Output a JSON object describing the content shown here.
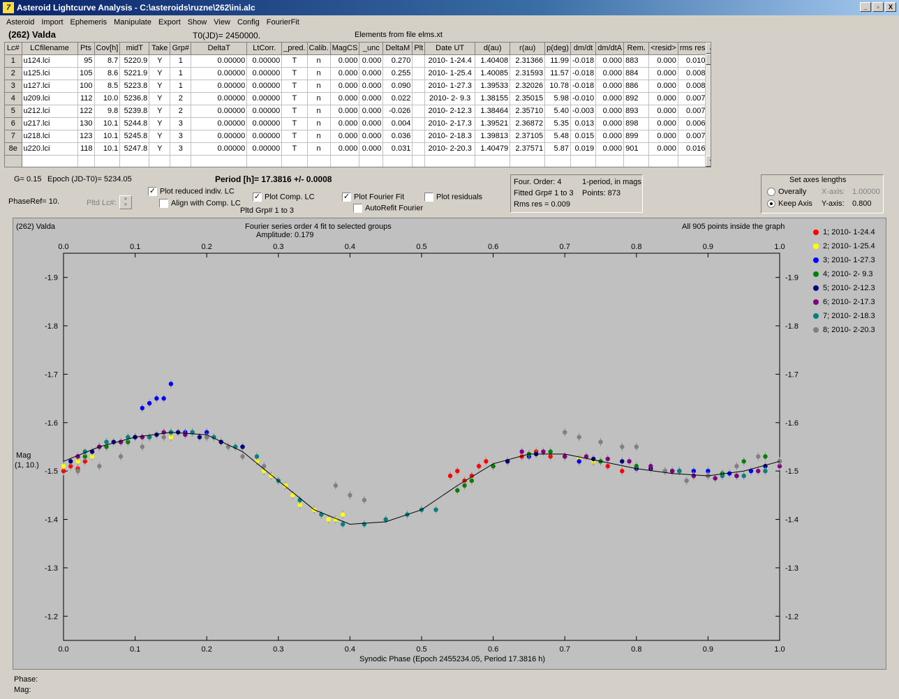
{
  "window": {
    "title": "Asteroid Lightcurve Analysis - C:\\asteroids\\ruzne\\262\\ini.alc",
    "app_icon_glyph": "7",
    "minimize_glyph": "_",
    "restore_glyph": "▫",
    "close_glyph": "X"
  },
  "menu": [
    "Asteroid",
    "Import",
    "Ephemeris",
    "Manipulate",
    "Export",
    "Show",
    "View",
    "Config",
    "FourierFit"
  ],
  "header": {
    "asteroid": "(262) Valda",
    "t0": "T0(JD)= 2450000.",
    "elements": "Elements from file elms.xt"
  },
  "table": {
    "columns": [
      "Lc#",
      "LCfilename",
      "Pts",
      "Cov[h]",
      "midT",
      "Take",
      "Grp#",
      "DeltaT",
      "LtCorr.",
      "_pred.",
      "Calib.",
      "MagCS",
      "_unc",
      "DeltaM",
      "Plt",
      "Date UT",
      "d(au)",
      "r(au)",
      "p(deg)",
      "dm/dt",
      "dm/dtA",
      "Rem.",
      "<resid>",
      "rms res"
    ],
    "rows": [
      [
        "1",
        "u124.lci",
        "95",
        "8.7",
        "5220.9",
        "Y",
        "1",
        "0.00000",
        "0.00000",
        "T",
        "n",
        "0.000",
        "0.000",
        "0.270",
        "",
        "2010- 1-24.4",
        "1.40408",
        "2.31366",
        "11.99",
        "-0.018",
        "0.000",
        "883",
        "0.000",
        "0.010"
      ],
      [
        "2",
        "u125.lci",
        "105",
        "8.6",
        "5221.9",
        "Y",
        "1",
        "0.00000",
        "0.00000",
        "T",
        "n",
        "0.000",
        "0.000",
        "0.255",
        "",
        "2010- 1-25.4",
        "1.40085",
        "2.31593",
        "11.57",
        "-0.018",
        "0.000",
        "884",
        "0.000",
        "0.008"
      ],
      [
        "3",
        "u127.lci",
        "100",
        "8.5",
        "5223.8",
        "Y",
        "1",
        "0.00000",
        "0.00000",
        "T",
        "n",
        "0.000",
        "0.000",
        "0.090",
        "",
        "2010- 1-27.3",
        "1.39533",
        "2.32026",
        "10.78",
        "-0.018",
        "0.000",
        "886",
        "0.000",
        "0.008"
      ],
      [
        "4",
        "u209.lci",
        "112",
        "10.0",
        "5236.8",
        "Y",
        "2",
        "0.00000",
        "0.00000",
        "T",
        "n",
        "0.000",
        "0.000",
        "0.022",
        "",
        "2010- 2- 9.3",
        "1.38155",
        "2.35015",
        "5.98",
        "-0.010",
        "0.000",
        "892",
        "0.000",
        "0.007"
      ],
      [
        "5",
        "u212.lci",
        "122",
        "9.8",
        "5239.8",
        "Y",
        "2",
        "0.00000",
        "0.00000",
        "T",
        "n",
        "0.000",
        "0.000",
        "-0.026",
        "",
        "2010- 2-12.3",
        "1.38464",
        "2.35710",
        "5.40",
        "-0.003",
        "0.000",
        "893",
        "0.000",
        "0.007"
      ],
      [
        "6",
        "u217.lci",
        "130",
        "10.1",
        "5244.8",
        "Y",
        "3",
        "0.00000",
        "0.00000",
        "T",
        "n",
        "0.000",
        "0.000",
        "0.004",
        "",
        "2010- 2-17.3",
        "1.39521",
        "2.36872",
        "5.35",
        "0.013",
        "0.000",
        "898",
        "0.000",
        "0.006"
      ],
      [
        "7",
        "u218.lci",
        "123",
        "10.1",
        "5245.8",
        "Y",
        "3",
        "0.00000",
        "0.00000",
        "T",
        "n",
        "0.000",
        "0.000",
        "0.036",
        "",
        "2010- 2-18.3",
        "1.39813",
        "2.37105",
        "5.48",
        "0.015",
        "0.000",
        "899",
        "0.000",
        "0.007"
      ],
      [
        "8e",
        "u220.lci",
        "118",
        "10.1",
        "5247.8",
        "Y",
        "3",
        "0.00000",
        "0.00000",
        "T",
        "n",
        "0.000",
        "0.000",
        "0.031",
        "",
        "2010- 2-20.3",
        "1.40479",
        "2.37571",
        "5.87",
        "0.019",
        "0.000",
        "901",
        "0.000",
        "0.016"
      ]
    ]
  },
  "controls": {
    "g_value": "G= 0.15",
    "epoch": "Epoch (JD-T0)= 5234.05",
    "period": "Period [h]= 17.3816 +/- 0.0008",
    "phase_ref": "PhaseRef= 10.",
    "pltd_lc": "Pltd Lc#:",
    "plot_reduced": "Plot reduced indiv. LC",
    "align_comp": "Align with Comp. LC",
    "plot_comp": "Plot Comp. LC",
    "pltd_grp": "Pltd Grp#  1  to   3",
    "plot_fourier": "Plot Fourier Fit",
    "autorefit": "AutoRefit Fourier",
    "plot_residuals": "Plot residuals",
    "check_mark": "✓",
    "plot_reduced_checked": true,
    "align_comp_checked": false,
    "plot_comp_checked": true,
    "plot_fourier_checked": true,
    "autorefit_checked": false,
    "plot_residuals_checked": false
  },
  "fourier_info": {
    "order": "Four. Order:  4",
    "period_mode": "1-period, in mags",
    "fitted": "Fitted Grp# 1 to 3",
    "points": "Points: 873",
    "rms": "Rms res     = 0.009"
  },
  "axes_box": {
    "title": "Set axes lengths",
    "overally": "Overally",
    "keep_axis": "Keep Axis",
    "x_axis_label": "X-axis:",
    "x_axis_value": "1.00000",
    "y_axis_label": "Y-axis:",
    "y_axis_value": "0.800",
    "selected": "Keep Axis"
  },
  "plot": {
    "name": "(262) Valda",
    "fit_title": "Fourier series order 4 fit to selected groups",
    "amplitude": "Amplitude: 0.179",
    "points_note": "All 905 points inside the graph",
    "ylabel_line1": "Mag",
    "ylabel_line2": "(1, 10.)",
    "xlabel": "Synodic Phase (Epoch 2455234.05, Period 17.3816 h)",
    "x_ticks": [
      "0.0",
      "0.1",
      "0.2",
      "0.3",
      "0.4",
      "0.5",
      "0.6",
      "0.7",
      "0.8",
      "0.9",
      "1.0"
    ],
    "y_ticks": [
      "-1.9",
      "-1.8",
      "-1.7",
      "-1.6",
      "-1.5",
      "-1.4",
      "-1.3",
      "-1.2"
    ]
  },
  "legend": [
    {
      "label": "1; 2010- 1-24.4",
      "color": "#ff0000"
    },
    {
      "label": "2; 2010- 1-25.4",
      "color": "#ffff00"
    },
    {
      "label": "3; 2010- 1-27.3",
      "color": "#0000ff"
    },
    {
      "label": "4; 2010- 2- 9.3",
      "color": "#008000"
    },
    {
      "label": "5; 2010- 2-12.3",
      "color": "#000080"
    },
    {
      "label": "6; 2010- 2-17.3",
      "color": "#800080"
    },
    {
      "label": "7; 2010- 2-18.3",
      "color": "#008080"
    },
    {
      "label": "8; 2010- 2-20.3",
      "color": "#808080"
    }
  ],
  "chart_data": {
    "type": "scatter",
    "title": "Fourier series order 4 fit to selected groups",
    "xlabel": "Synodic Phase (Epoch 2455234.05, Period 17.3816 h)",
    "ylabel": "Mag (1, 10.)",
    "xlim": [
      0.0,
      1.0
    ],
    "ylim": [
      -1.95,
      -1.15
    ],
    "y_inverted": true,
    "grid": false,
    "legend_position": "right",
    "fourier_curve": {
      "x": [
        0.0,
        0.05,
        0.1,
        0.15,
        0.2,
        0.25,
        0.3,
        0.35,
        0.4,
        0.45,
        0.5,
        0.55,
        0.6,
        0.65,
        0.7,
        0.75,
        0.8,
        0.85,
        0.9,
        0.95,
        1.0
      ],
      "y": [
        -1.52,
        -1.55,
        -1.57,
        -1.58,
        -1.575,
        -1.54,
        -1.48,
        -1.42,
        -1.39,
        -1.395,
        -1.42,
        -1.47,
        -1.515,
        -1.535,
        -1.535,
        -1.52,
        -1.505,
        -1.495,
        -1.49,
        -1.5,
        -1.52
      ]
    },
    "series": [
      {
        "name": "1; 2010- 1-24.4",
        "x": [
          0.0,
          0.01,
          0.02,
          0.03,
          0.54,
          0.55,
          0.56,
          0.57,
          0.58,
          0.59,
          0.6,
          0.62,
          0.64,
          0.66,
          0.68,
          0.7,
          0.72,
          0.74,
          0.76,
          0.78,
          0.8
        ],
        "y": [
          -1.5,
          -1.51,
          -1.505,
          -1.52,
          -1.49,
          -1.5,
          -1.48,
          -1.49,
          -1.51,
          -1.52,
          -1.51,
          -1.52,
          -1.53,
          -1.54,
          -1.53,
          -1.53,
          -1.52,
          -1.52,
          -1.51,
          -1.5,
          -1.505
        ]
      },
      {
        "name": "2; 2010- 1-25.4",
        "x": [
          0.0,
          0.02,
          0.04,
          0.15,
          0.27,
          0.28,
          0.29,
          0.3,
          0.31,
          0.32,
          0.33,
          0.35,
          0.36,
          0.37,
          0.38,
          0.39,
          0.4,
          0.7,
          0.72,
          0.74
        ],
        "y": [
          -1.51,
          -1.52,
          -1.53,
          -1.57,
          -1.52,
          -1.5,
          -1.49,
          -1.48,
          -1.47,
          -1.45,
          -1.43,
          -1.42,
          -1.41,
          -1.4,
          -1.4,
          -1.41,
          -1.45,
          -1.53,
          -1.525,
          -1.52
        ]
      },
      {
        "name": "3; 2010- 1-27.3",
        "x": [
          0.02,
          0.05,
          0.08,
          0.1,
          0.11,
          0.12,
          0.13,
          0.14,
          0.15,
          0.17,
          0.2,
          0.25,
          0.65,
          0.72,
          0.8,
          0.85,
          0.88,
          0.9,
          0.93,
          0.96,
          1.0
        ],
        "y": [
          -1.53,
          -1.55,
          -1.56,
          -1.57,
          -1.63,
          -1.64,
          -1.65,
          -1.65,
          -1.68,
          -1.58,
          -1.58,
          -1.55,
          -1.53,
          -1.52,
          -1.505,
          -1.5,
          -1.5,
          -1.5,
          -1.495,
          -1.5,
          -1.52
        ]
      },
      {
        "name": "4; 2010- 2- 9.3",
        "x": [
          0.03,
          0.06,
          0.09,
          0.12,
          0.15,
          0.18,
          0.55,
          0.56,
          0.57,
          0.6,
          0.62,
          0.65,
          0.68,
          0.75,
          0.8,
          0.84,
          0.88,
          0.92,
          0.95,
          0.98
        ],
        "y": [
          -1.53,
          -1.55,
          -1.56,
          -1.57,
          -1.58,
          -1.58,
          -1.46,
          -1.47,
          -1.48,
          -1.51,
          -1.52,
          -1.535,
          -1.54,
          -1.52,
          -1.51,
          -1.5,
          -1.49,
          -1.495,
          -1.52,
          -1.53
        ]
      },
      {
        "name": "5; 2010- 2-12.3",
        "x": [
          0.01,
          0.04,
          0.07,
          0.1,
          0.13,
          0.16,
          0.19,
          0.22,
          0.25,
          0.62,
          0.66,
          0.7,
          0.74,
          0.78,
          0.82,
          0.86,
          0.9,
          0.94,
          0.98
        ],
        "y": [
          -1.52,
          -1.54,
          -1.56,
          -1.57,
          -1.575,
          -1.58,
          -1.57,
          -1.56,
          -1.55,
          -1.52,
          -1.535,
          -1.53,
          -1.525,
          -1.52,
          -1.505,
          -1.5,
          -1.49,
          -1.49,
          -1.51
        ]
      },
      {
        "name": "6; 2010- 2-17.3",
        "x": [
          0.02,
          0.05,
          0.08,
          0.11,
          0.14,
          0.17,
          0.2,
          0.64,
          0.67,
          0.7,
          0.73,
          0.76,
          0.79,
          0.82,
          0.85,
          0.88,
          0.91,
          0.94,
          0.97,
          1.0
        ],
        "y": [
          -1.53,
          -1.55,
          -1.56,
          -1.57,
          -1.58,
          -1.575,
          -1.57,
          -1.54,
          -1.54,
          -1.53,
          -1.53,
          -1.525,
          -1.52,
          -1.51,
          -1.5,
          -1.49,
          -1.485,
          -1.49,
          -1.5,
          -1.51
        ]
      },
      {
        "name": "7; 2010- 2-18.3",
        "x": [
          0.03,
          0.06,
          0.09,
          0.12,
          0.15,
          0.18,
          0.21,
          0.24,
          0.27,
          0.3,
          0.33,
          0.36,
          0.39,
          0.42,
          0.45,
          0.48,
          0.5,
          0.52,
          0.86,
          0.92,
          0.95,
          0.98
        ],
        "y": [
          -1.54,
          -1.56,
          -1.57,
          -1.57,
          -1.58,
          -1.58,
          -1.57,
          -1.55,
          -1.53,
          -1.48,
          -1.44,
          -1.41,
          -1.39,
          -1.39,
          -1.4,
          -1.41,
          -1.42,
          -1.42,
          -1.5,
          -1.49,
          -1.49,
          -1.5
        ]
      },
      {
        "name": "8; 2010- 2-20.3",
        "x": [
          0.02,
          0.05,
          0.08,
          0.11,
          0.14,
          0.2,
          0.23,
          0.25,
          0.28,
          0.38,
          0.4,
          0.42,
          0.7,
          0.72,
          0.75,
          0.78,
          0.8,
          0.84,
          0.87,
          0.9,
          0.94,
          0.97,
          1.0
        ],
        "y": [
          -1.5,
          -1.51,
          -1.53,
          -1.55,
          -1.57,
          -1.57,
          -1.55,
          -1.53,
          -1.51,
          -1.47,
          -1.45,
          -1.44,
          -1.58,
          -1.57,
          -1.56,
          -1.55,
          -1.55,
          -1.5,
          -1.48,
          -1.49,
          -1.51,
          -1.53,
          -1.52
        ]
      }
    ]
  },
  "status": {
    "phase": "Phase:",
    "mag": "Mag:"
  }
}
